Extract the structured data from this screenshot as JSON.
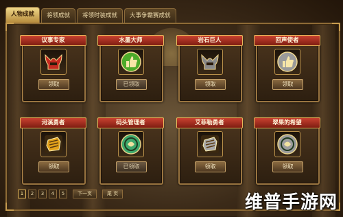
{
  "tabs": [
    {
      "label": "人物成就"
    },
    {
      "label": "将领成就"
    },
    {
      "label": "将领时装成就"
    },
    {
      "label": "大事争霸赛成就"
    }
  ],
  "cards": [
    {
      "title": "议事专家",
      "button": "领取",
      "status": "unclaimed",
      "icon": "helmet-icon",
      "color": "#c42a20"
    },
    {
      "title": "水墨大师",
      "button": "已领取",
      "status": "claimed",
      "icon": "thumbs-up-icon",
      "color": "#4caa2a"
    },
    {
      "title": "岩石巨人",
      "button": "领取",
      "status": "unclaimed",
      "icon": "helmet-icon",
      "color": "#8a8a8a"
    },
    {
      "title": "回声使者",
      "button": "领取",
      "status": "unclaimed",
      "icon": "thumbs-up-icon",
      "color": "#9a9a9a"
    },
    {
      "title": "河溪勇者",
      "button": "领取",
      "status": "unclaimed",
      "icon": "fist-icon",
      "color": "#e3a21a"
    },
    {
      "title": "码头管理者",
      "button": "已领取",
      "status": "claimed",
      "icon": "coin-icon",
      "color": "#3fa86c"
    },
    {
      "title": "艾菲勒勇者",
      "button": "领取",
      "status": "unclaimed",
      "icon": "fist-icon",
      "color": "#a8a8a8"
    },
    {
      "title": "翠果的希望",
      "button": "领取",
      "status": "unclaimed",
      "icon": "coin-icon",
      "color": "#9c9c9c"
    }
  ],
  "pager": {
    "pages": [
      "1",
      "2",
      "3",
      "4",
      "5"
    ],
    "current": "1",
    "next_label": "下一页",
    "last_label": "尾 页"
  },
  "watermark": "维普手游网"
}
